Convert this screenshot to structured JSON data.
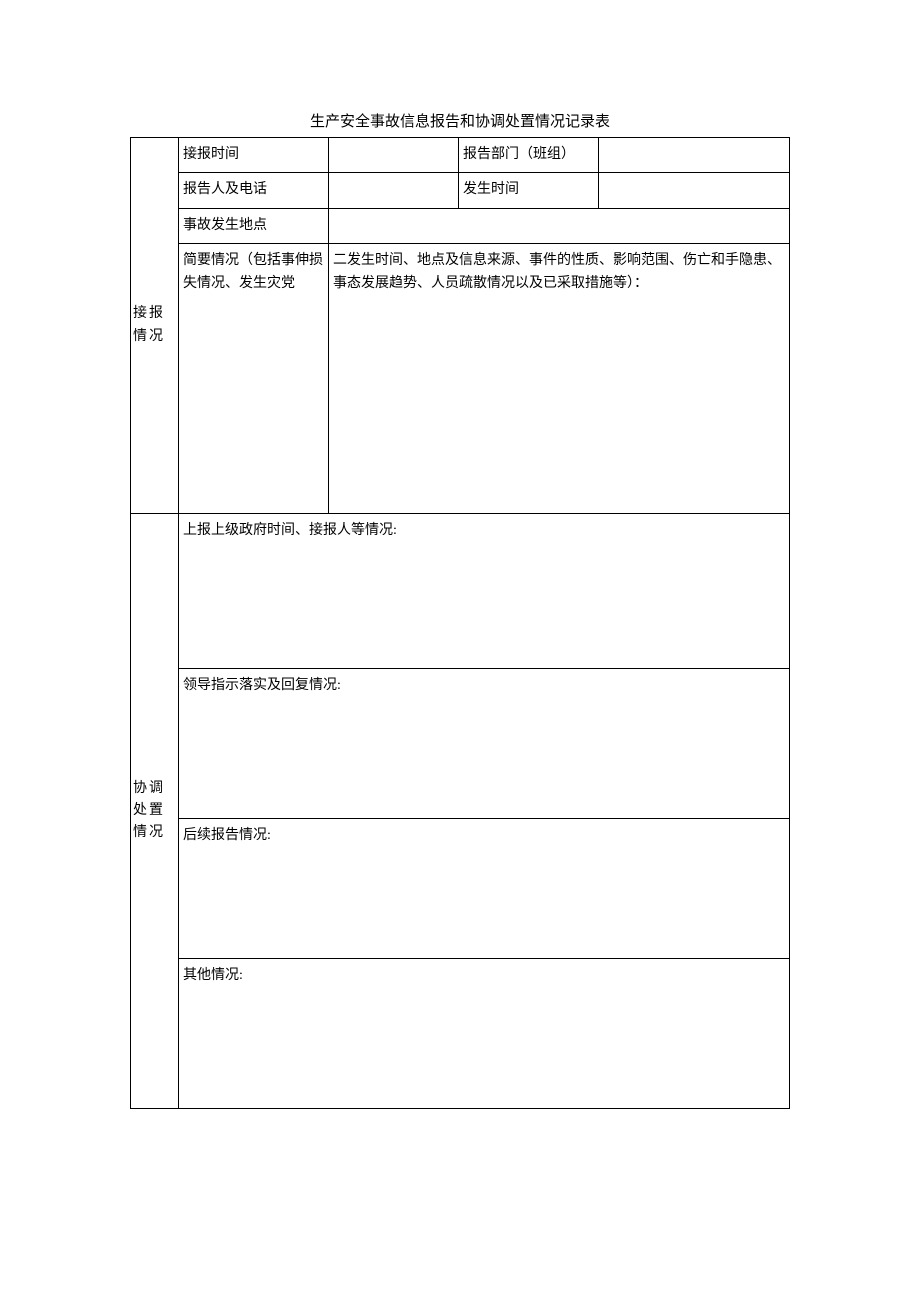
{
  "title": "生产安全事故信息报告和协调处置情况记录表",
  "sections": {
    "received": {
      "label": "接报情况",
      "rows": {
        "r1": {
          "label": "接报时间",
          "value": "",
          "label2": "报告部门（班组）",
          "value2": ""
        },
        "r2": {
          "label": "报告人及电话",
          "value": "",
          "label2": "发生时间",
          "value2": ""
        },
        "r3": {
          "label": "事故发生地点",
          "value": ""
        },
        "r4": {
          "label": "简要情况（包括事伸损失情况、发生灾党",
          "value": "二发生时间、地点及信息来源、事件的性质、影响范围、伤亡和手隐患、事态发展趋势、人员疏散情况以及已采取措施等）："
        }
      }
    },
    "coord": {
      "label": "协调处置情况",
      "rows": {
        "c1": {
          "label": "上报上级政府时间、接报人等情况:"
        },
        "c2": {
          "label": "领导指示落实及回复情况:"
        },
        "c3": {
          "label": "后续报告情况:"
        },
        "c4": {
          "label": "其他情况:"
        }
      }
    }
  }
}
